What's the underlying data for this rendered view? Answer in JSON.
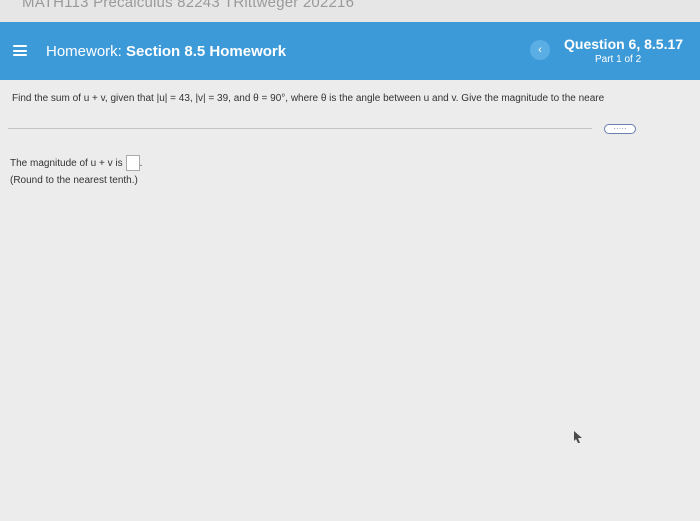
{
  "topbar": {
    "course": "MATH113 Precalculus 82243 TRittweger 202216"
  },
  "header": {
    "menu_icon": "hamburger-menu-icon",
    "hw_prefix": "Homework:",
    "hw_title": "Section 8.5 Homework",
    "prev_icon": "chevron-left-icon",
    "prev_glyph": "‹",
    "question": "Question 6, 8.5.17",
    "part": "Part 1 of 2"
  },
  "problem": {
    "prompt": "Find the sum of u + v, given that |u| = 43, |v| = 39, and θ = 90°, where θ is the angle between u and v. Give the magnitude to the neare",
    "more_label": "·····",
    "answer_label": "The magnitude of u + v is",
    "answer_value": "",
    "answer_suffix": ".",
    "round_note": "(Round to the nearest tenth.)"
  },
  "colors": {
    "header_bg": "#3d9ad8",
    "page_bg": "#ececec"
  }
}
